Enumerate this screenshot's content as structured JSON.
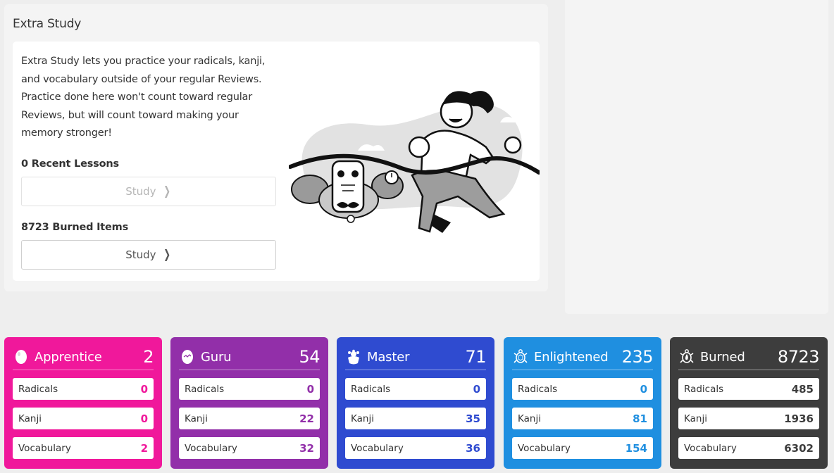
{
  "extra_study": {
    "title": "Extra Study",
    "description": "Extra Study lets you practice your radicals, kanji, and vocabulary outside of your regular Reviews. Practice done here won't count toward regular Reviews, but will count toward making your memory stronger!",
    "recent_lessons": {
      "label": "0 Recent Lessons",
      "button_label": "Study",
      "enabled": false
    },
    "burned_items": {
      "label": "8723 Burned Items",
      "button_label": "Study",
      "enabled": true
    },
    "illustration": "runner-crossing-finish-line-illustration"
  },
  "srs_stages": [
    {
      "name": "Apprentice",
      "total": "2",
      "color": "#f0189b",
      "icon": "egg-icon",
      "rows": [
        {
          "label": "Radicals",
          "value": "0"
        },
        {
          "label": "Kanji",
          "value": "0"
        },
        {
          "label": "Vocabulary",
          "value": "2"
        }
      ]
    },
    {
      "name": "Guru",
      "total": "54",
      "color": "#922fa9",
      "icon": "cracked-egg-icon",
      "rows": [
        {
          "label": "Radicals",
          "value": "0"
        },
        {
          "label": "Kanji",
          "value": "22"
        },
        {
          "label": "Vocabulary",
          "value": "32"
        }
      ]
    },
    {
      "name": "Master",
      "total": "71",
      "color": "#2f4bd0",
      "icon": "hatching-turtle-icon",
      "rows": [
        {
          "label": "Radicals",
          "value": "0"
        },
        {
          "label": "Kanji",
          "value": "35"
        },
        {
          "label": "Vocabulary",
          "value": "36"
        }
      ]
    },
    {
      "name": "Enlightened",
      "total": "235",
      "color": "#1f8fe0",
      "icon": "turtle-icon",
      "rows": [
        {
          "label": "Radicals",
          "value": "0"
        },
        {
          "label": "Kanji",
          "value": "81"
        },
        {
          "label": "Vocabulary",
          "value": "154"
        }
      ]
    },
    {
      "name": "Burned",
      "total": "8723",
      "color": "#3d3d3d",
      "icon": "burned-turtle-icon",
      "rows": [
        {
          "label": "Radicals",
          "value": "485"
        },
        {
          "label": "Kanji",
          "value": "1936"
        },
        {
          "label": "Vocabulary",
          "value": "6302"
        }
      ]
    }
  ]
}
